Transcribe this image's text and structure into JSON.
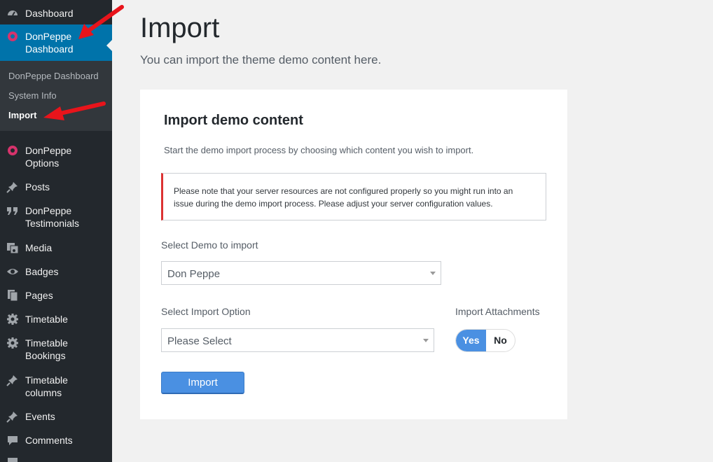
{
  "sidebar": {
    "items": [
      {
        "label": "Dashboard",
        "icon": "dashboard-icon"
      },
      {
        "label": "DonPeppe\nDashboard",
        "icon": "donpeppe-icon"
      },
      {
        "label": "DonPeppe\nOptions",
        "icon": "donpeppe-options-icon"
      },
      {
        "label": "Posts",
        "icon": "pin-icon"
      },
      {
        "label": "DonPeppe\nTestimonials",
        "icon": "quote-icon"
      },
      {
        "label": "Media",
        "icon": "media-icon"
      },
      {
        "label": "Badges",
        "icon": "eye-icon"
      },
      {
        "label": "Pages",
        "icon": "pages-icon"
      },
      {
        "label": "Timetable",
        "icon": "gear-icon"
      },
      {
        "label": "Timetable\nBookings",
        "icon": "gear-icon"
      },
      {
        "label": "Timetable\ncolumns",
        "icon": "pin-icon"
      },
      {
        "label": "Events",
        "icon": "pin-icon"
      },
      {
        "label": "Comments",
        "icon": "comment-icon"
      }
    ],
    "submenu": [
      "DonPeppe Dashboard",
      "System Info",
      "Import"
    ]
  },
  "page": {
    "title": "Import",
    "subtitle": "You can import the theme demo content here."
  },
  "card": {
    "title": "Import demo content",
    "description": "Start the demo import process by choosing which content you wish to import.",
    "notice_line1": "Please note that your server resources are not configured properly so you might run into an",
    "notice_line2": "issue during the demo import process. Please adjust your server configuration values.",
    "demo_label": "Select Demo to import",
    "demo_value": "Don Peppe",
    "option_label": "Select Import Option",
    "option_value": "Please Select",
    "attachments_label": "Import Attachments",
    "toggle_yes": "Yes",
    "toggle_no": "No",
    "attachments_selected": "Yes",
    "import_button": "Import"
  },
  "colors": {
    "sidebar_bg": "#23282d",
    "active_bg": "#0073aa",
    "accent": "#4a90e2",
    "notice_border": "#dc3232",
    "annotation_arrow": "#e8141b"
  }
}
